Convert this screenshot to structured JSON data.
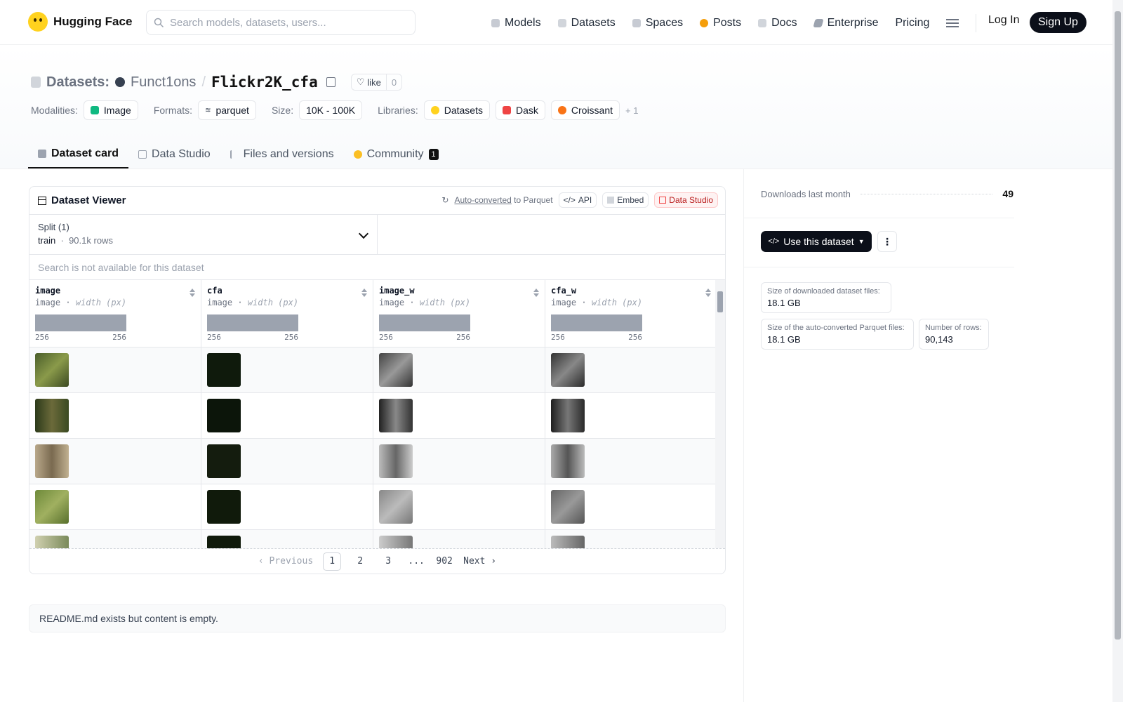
{
  "nav": {
    "brand": "Hugging Face",
    "search_placeholder": "Search models, datasets, users...",
    "links": [
      "Models",
      "Datasets",
      "Spaces",
      "Posts",
      "Docs",
      "Enterprise",
      "Pricing"
    ],
    "login": "Log In",
    "signup": "Sign Up"
  },
  "header": {
    "section": "Datasets:",
    "org": "Funct1ons",
    "repo": "Flickr2K_cfa",
    "like_label": "like",
    "like_count": "0",
    "modalities_label": "Modalities:",
    "modality": "Image",
    "formats_label": "Formats:",
    "format": "parquet",
    "size_label": "Size:",
    "size": "10K - 100K",
    "libraries_label": "Libraries:",
    "libraries": [
      "Datasets",
      "Dask",
      "Croissant"
    ],
    "more_libs": "+ 1"
  },
  "tabs": {
    "dataset_card": "Dataset card",
    "data_studio": "Data Studio",
    "files": "Files and versions",
    "community": "Community",
    "community_count": "1"
  },
  "viewer": {
    "title": "Dataset Viewer",
    "auto_converted": "Auto-converted",
    "to_parquet": "to Parquet",
    "api": "API",
    "embed": "Embed",
    "data_studio": "Data Studio",
    "split_label": "Split (1)",
    "split_name": "train",
    "split_rows": "90.1k rows",
    "search_msg": "Search is not available for this dataset",
    "columns": [
      {
        "name": "image",
        "type": "image",
        "sub": "width (px)",
        "min": "256",
        "max": "256"
      },
      {
        "name": "cfa",
        "type": "image",
        "sub": "width (px)",
        "min": "256",
        "max": "256"
      },
      {
        "name": "image_w",
        "type": "image",
        "sub": "width (px)",
        "min": "256",
        "max": "256"
      },
      {
        "name": "cfa_w",
        "type": "image",
        "sub": "width (px)",
        "min": "256",
        "max": "256"
      }
    ],
    "pagination": {
      "prev": "Previous",
      "pages": [
        "1",
        "2",
        "3",
        "...",
        "902"
      ],
      "next": "Next"
    }
  },
  "readme": "README.md exists but content is empty.",
  "sidebar": {
    "downloads_label": "Downloads last month",
    "downloads": "49",
    "use_button": "Use this dataset",
    "size_files_label": "Size of downloaded dataset files:",
    "size_files": "18.1 GB",
    "size_parquet_label": "Size of the auto-converted Parquet files:",
    "size_parquet": "18.1 GB",
    "rows_label": "Number of rows:",
    "rows": "90,143"
  },
  "colors": {
    "accent": "#0b0f19",
    "brand": "#ffd21e",
    "data_studio": "#b91c1c"
  }
}
